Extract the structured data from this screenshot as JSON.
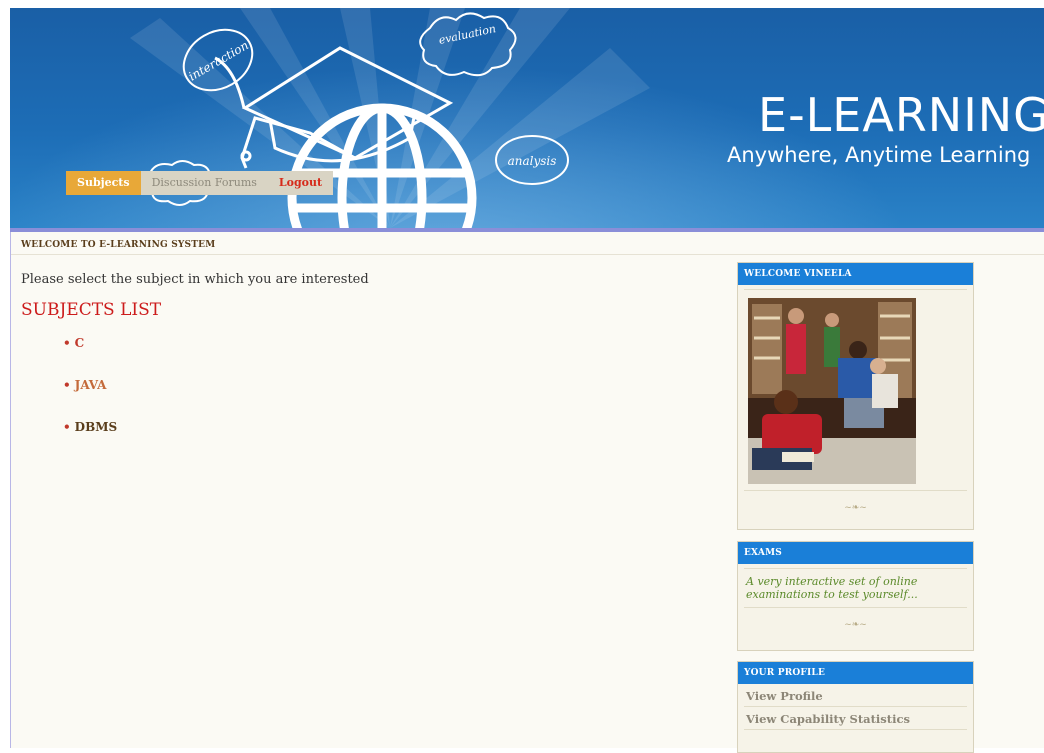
{
  "header": {
    "title": "E-LEARNING",
    "tagline": "Anywhere, Anytime Learning",
    "bubbles": [
      "interaction",
      "evaluation",
      "analysis"
    ]
  },
  "nav": {
    "subjects": "Subjects",
    "forums": "Discussion Forums",
    "logout": "Logout"
  },
  "page": {
    "breadcrumb": "WELCOME TO E-LEARNING SYSTEM",
    "intro": "Please select the subject in which you are interested",
    "list_title": "SUBJECTS LIST",
    "subjects": [
      {
        "label": "C",
        "color": "#c0392b"
      },
      {
        "label": "JAVA",
        "color": "#c46a3a"
      },
      {
        "label": "DBMS",
        "color": "#5a3e1c"
      }
    ]
  },
  "sidebar": {
    "welcome": {
      "title": "WELCOME VINEELA",
      "ornament": "~❧~"
    },
    "exams": {
      "title": "EXAMS",
      "text": "A very interactive set of online examinations to test yourself...",
      "ornament": "~❧~"
    },
    "profile": {
      "title": "YOUR PROFILE",
      "links": [
        "View Profile",
        "View Capability Statistics"
      ]
    }
  },
  "colors": {
    "banner_blue": "#1d6db6",
    "box_header_blue": "#1a7fd8",
    "nav_active": "#e8a838",
    "logout_red": "#d62a1a",
    "title_red": "#cc1b1b"
  }
}
